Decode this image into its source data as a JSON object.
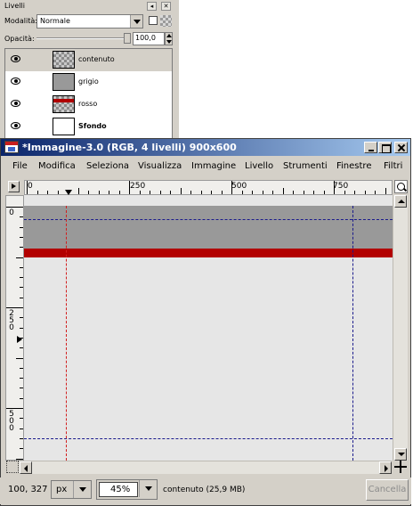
{
  "layers_dock": {
    "title": "Livelli",
    "mode_label": "Modalità:",
    "mode_value": "Normale",
    "opacity_label": "Opacità:",
    "opacity_value": "100,0",
    "opacity_percent": 100,
    "layers": [
      {
        "name": "contenuto",
        "visible": true,
        "selected": true
      },
      {
        "name": "grigio",
        "visible": true,
        "selected": false
      },
      {
        "name": "rosso",
        "visible": true,
        "selected": false
      },
      {
        "name": "Sfondo",
        "visible": true,
        "selected": false
      }
    ]
  },
  "image_window": {
    "title": "*Immagine-3.0 (RGB, 4 livelli) 900x600",
    "menu": [
      "File",
      "Modifica",
      "Seleziona",
      "Visualizza",
      "Immagine",
      "Livello",
      "Strumenti",
      "Finestre",
      "Filtri"
    ],
    "hruler_labels": [
      "0",
      "250",
      "500",
      "750"
    ],
    "vruler_labels": [
      "0",
      "250",
      "500"
    ],
    "colors": {
      "grey_layer": "#999999",
      "red_layer": "#b20000",
      "background": "#e6e6e6",
      "guide": "#1a1a8c",
      "guide_red": "#d21e1e"
    }
  },
  "statusbar": {
    "coords": "100, 327",
    "unit": "px",
    "zoom": "45%",
    "message": "contenuto (25,9 MB)",
    "cancel_label": "Cancella"
  }
}
